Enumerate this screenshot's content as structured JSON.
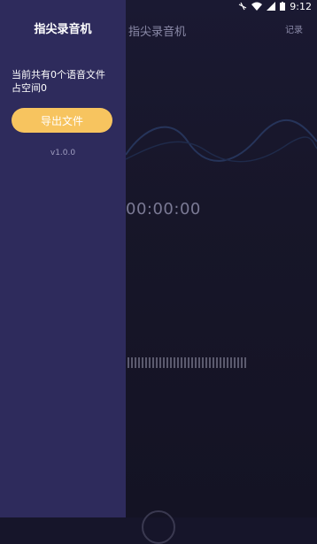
{
  "status_bar": {
    "time": "9:12",
    "icons": [
      "vibrate-icon",
      "wifi-icon",
      "signal-icon",
      "battery-icon"
    ]
  },
  "main": {
    "title": "指尖录音机",
    "records_label": "记录",
    "timer": "00:00:00"
  },
  "drawer": {
    "title": "指尖录音机",
    "info_line1": "当前共有0个语音文件",
    "info_line2": "占空间0",
    "export_label": "导出文件",
    "version": "v1.0.0"
  },
  "colors": {
    "drawer_bg": "#2e2b5c",
    "main_bg": "#16152a",
    "export_button": "#f7c45f"
  }
}
